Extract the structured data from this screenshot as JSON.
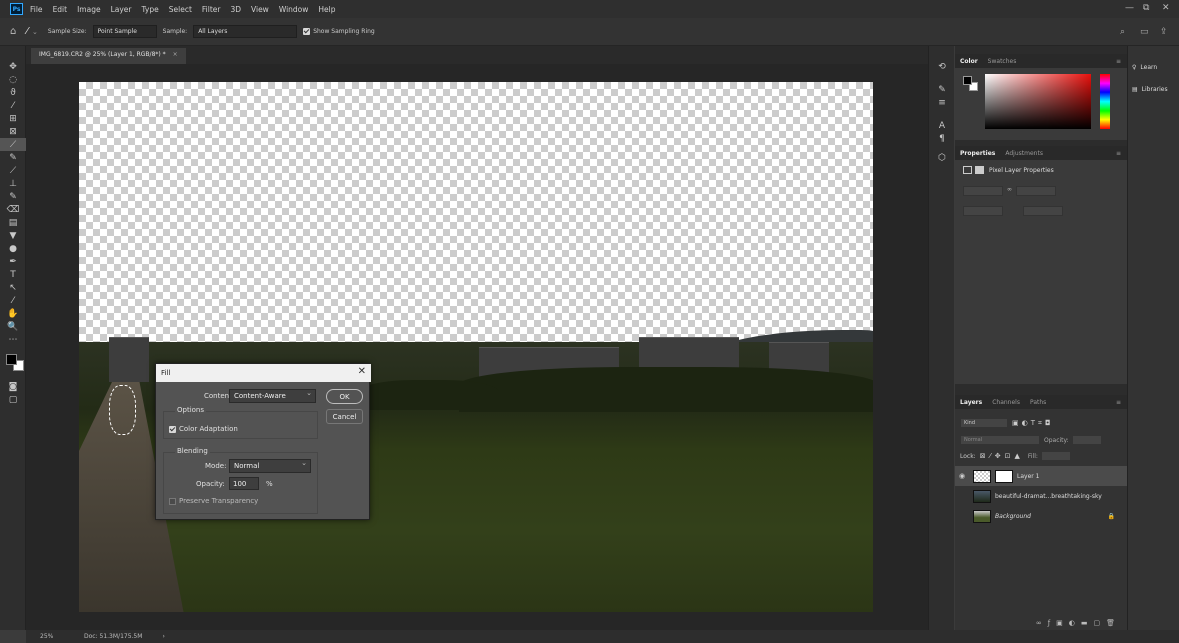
{
  "app": {
    "logo": "Ps",
    "menu": [
      "File",
      "Edit",
      "Image",
      "Layer",
      "Type",
      "Select",
      "Filter",
      "3D",
      "View",
      "Window",
      "Help"
    ],
    "window_controls": [
      "—",
      "⧉",
      "✕"
    ]
  },
  "options_bar": {
    "tool_icon": "eyedropper-icon",
    "sample_size_label": "Sample Size:",
    "sample_size_value": "Point Sample",
    "sample_label": "Sample:",
    "sample_value": "All Layers",
    "show_ring_label": "Show Sampling Ring"
  },
  "document_tab": {
    "title": "IMG_6819.CR2 @ 25% (Layer 1, RGB/8*) *",
    "close": "×"
  },
  "fill_dialog": {
    "title": "Fill",
    "close": "✕",
    "contents_label": "Contents:",
    "contents_value": "Content-Aware",
    "ok_label": "OK",
    "cancel_label": "Cancel",
    "options_label": "Options",
    "color_adaptation_label": "Color Adaptation",
    "blending_label": "Blending",
    "mode_label": "Mode:",
    "mode_value": "Normal",
    "opacity_label": "Opacity:",
    "opacity_value": "100",
    "opacity_unit": "%",
    "preserve_label": "Preserve Transparency"
  },
  "color_panel": {
    "tabs": [
      "Color",
      "Swatches"
    ]
  },
  "properties_panel": {
    "tabs": [
      "Properties",
      "Adjustments"
    ],
    "section_title": "Pixel Layer Properties"
  },
  "layers_panel": {
    "tabs": [
      "Layers",
      "Channels",
      "Paths"
    ],
    "filter_kind": "Kind",
    "blend_mode": "Normal",
    "opacity_label": "Opacity:",
    "lock_label": "Lock:",
    "fill_label": "Fill:",
    "layers": [
      {
        "name": "Layer 1"
      },
      {
        "name": "beautiful-dramat...breathtaking-sky"
      },
      {
        "name": "Background"
      }
    ]
  },
  "right_dock": {
    "learn": "Learn",
    "libraries": "Libraries"
  },
  "status_bar": {
    "zoom": "25%",
    "doc": "Doc: 51.3M/175.5M",
    "arrow": "›"
  },
  "tools": [
    "✥",
    "◌",
    "ϑ",
    "⁄",
    "⊞",
    "⊠",
    "⟋",
    "✎",
    "⟋",
    "⊥",
    "✎",
    "⌫",
    "▤",
    "▼",
    "●",
    "✒",
    "T",
    "↖",
    "⁄",
    "✋",
    "🔍",
    "⋯"
  ]
}
